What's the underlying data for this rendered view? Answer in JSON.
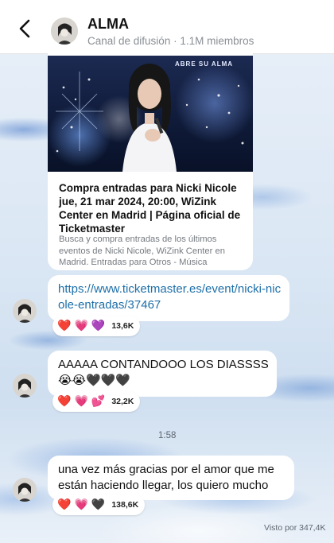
{
  "header": {
    "channel_name": "ALMA",
    "subtitle": "Canal de difusión · 1,1M miembros"
  },
  "link_card": {
    "image_caption": "ABRE SU ALMA",
    "title": "Compra entradas para Nicki Nicole jue, 21 mar 2024, 20:00, WiZink Center en Madrid | Página oficial de Ticketmaster",
    "description": "Busca y compra entradas de los últimos eventos de Nicki Nicole, WiZink Center en Madrid. Entradas para Otros - Música"
  },
  "messages": [
    {
      "text": "https://www.ticketmaster.es/event/nicki-nicole-entradas/37467",
      "reactions": {
        "emojis": [
          "❤️",
          "💗",
          "💜"
        ],
        "count": "13,6K"
      }
    },
    {
      "text": "AAAAA CONTANDOOO LOS DIASSSS 😭😭🖤🖤🖤",
      "reactions": {
        "emojis": [
          "❤️",
          "💗",
          "💕"
        ],
        "count": "32,2K"
      }
    },
    {
      "text": "una vez más gracias por el amor que me están haciendo llegar, los quiero mucho",
      "reactions": {
        "emojis": [
          "❤️",
          "💗",
          "🖤"
        ],
        "count": "138,6K"
      }
    }
  ],
  "time_separator": "1:58",
  "views": "Visto por 347,4K"
}
